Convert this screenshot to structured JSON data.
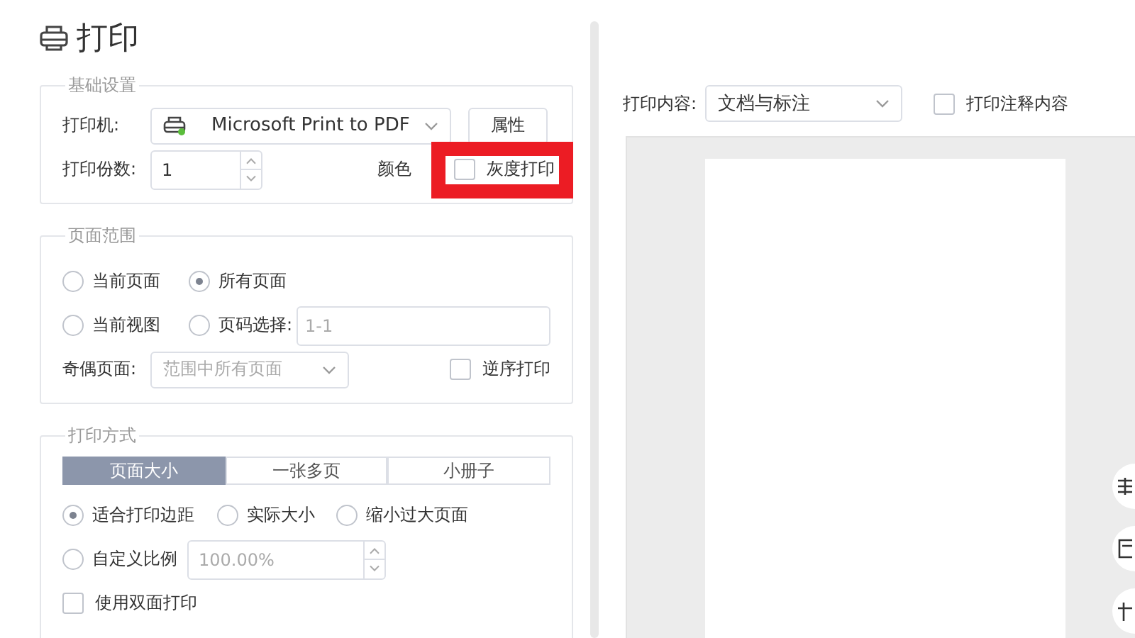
{
  "title": "打印",
  "basic": {
    "legend": "基础设置",
    "printer_label": "打印机:",
    "printer": "Microsoft Print to PDF",
    "properties_button": "属性",
    "copies_label": "打印份数:",
    "copies": "1",
    "color_label": "颜色",
    "grayscale": {
      "label": "灰度打印",
      "checked": false
    }
  },
  "page_range": {
    "legend": "页面范围",
    "options": [
      {
        "label": "当前页面",
        "selected": false
      },
      {
        "label": "所有页面",
        "selected": true
      },
      {
        "label": "当前视图",
        "selected": false
      },
      {
        "label": "页码选择:",
        "selected": false
      }
    ],
    "page_numbers": {
      "value": "1-1",
      "disabled": true
    },
    "odd_even_label": "奇偶页面:",
    "odd_even": {
      "value": "范围中所有页面",
      "disabled": true
    },
    "reverse": {
      "label": "逆序打印",
      "checked": false
    }
  },
  "print_mode": {
    "legend": "打印方式",
    "tabs": [
      {
        "label": "页面大小",
        "selected": true
      },
      {
        "label": "一张多页",
        "selected": false
      },
      {
        "label": "小册子",
        "selected": false
      }
    ],
    "scale_options": [
      {
        "label": "适合打印边距",
        "selected": true
      },
      {
        "label": "实际大小",
        "selected": false
      },
      {
        "label": "缩小过大页面",
        "selected": false
      },
      {
        "label": "自定义比例",
        "selected": false
      }
    ],
    "custom_scale": {
      "value": "100.00%",
      "disabled": true
    },
    "duplex": {
      "label": "使用双面打印",
      "checked": false
    }
  },
  "preview": {
    "content_label": "打印内容:",
    "content": "文档与标注",
    "annotations": {
      "label": "打印注释内容",
      "checked": false
    }
  }
}
